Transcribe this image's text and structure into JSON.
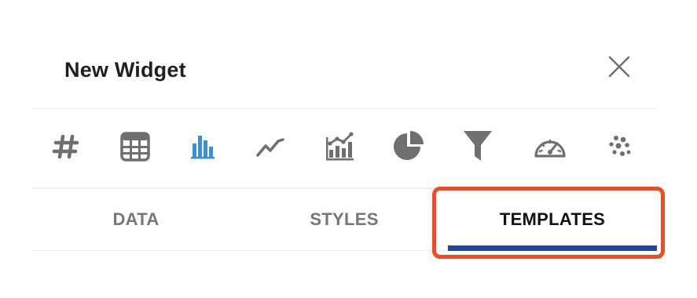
{
  "dialog": {
    "title": "New Widget",
    "close_icon": "close-icon"
  },
  "chart_types": [
    {
      "name": "number",
      "icon": "hash-icon",
      "active": false
    },
    {
      "name": "table",
      "icon": "table-icon",
      "active": false
    },
    {
      "name": "bar",
      "icon": "bar-chart-icon",
      "active": true
    },
    {
      "name": "line",
      "icon": "line-chart-icon",
      "active": false
    },
    {
      "name": "combo",
      "icon": "combo-chart-icon",
      "active": false
    },
    {
      "name": "pie",
      "icon": "pie-chart-icon",
      "active": false
    },
    {
      "name": "funnel",
      "icon": "funnel-icon",
      "active": false
    },
    {
      "name": "gauge",
      "icon": "gauge-icon",
      "active": false
    },
    {
      "name": "scatter",
      "icon": "scatter-icon",
      "active": false
    }
  ],
  "tabs": [
    {
      "label": "DATA",
      "active": false
    },
    {
      "label": "STYLES",
      "active": false
    },
    {
      "label": "TEMPLATES",
      "active": true
    }
  ],
  "colors": {
    "icon_default": "#6f6f6f",
    "icon_active": "#3a8fd6",
    "tab_underline": "#1e47a0",
    "highlight_border": "#f04b23"
  }
}
